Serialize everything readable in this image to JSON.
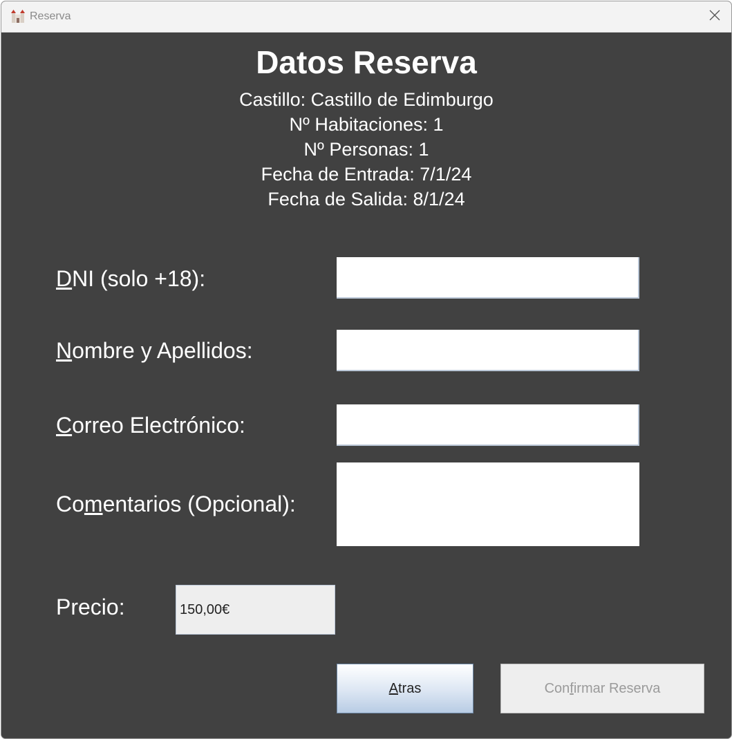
{
  "window": {
    "title": "Reserva",
    "icon": "castle-icon",
    "close_icon": "close-icon"
  },
  "header": {
    "title": "Datos Reserva",
    "castle": "Castillo: Castillo de Edimburgo",
    "rooms": "Nº Habitaciones: 1",
    "people": "Nº Personas: 1",
    "check_in": "Fecha de Entrada: 7/1/24",
    "check_out": "Fecha de Salida: 8/1/24"
  },
  "form": {
    "dni": {
      "mnemonic": "D",
      "rest": "NI (solo +18):",
      "value": ""
    },
    "nombre": {
      "mnemonic": "N",
      "rest": "ombre y Apellidos:",
      "value": ""
    },
    "correo": {
      "mnemonic": "C",
      "rest": "orreo Electrónico:",
      "value": ""
    },
    "comentarios": {
      "pre": "Co",
      "mnemonic": "m",
      "rest": "entarios (Opcional):",
      "value": ""
    }
  },
  "price": {
    "label": "Precio:",
    "value": "150,00€"
  },
  "buttons": {
    "back": {
      "mnemonic": "A",
      "rest": "tras"
    },
    "confirm": {
      "pre": "Con",
      "mnemonic": "f",
      "rest": "irmar Reserva",
      "enabled": false
    }
  }
}
